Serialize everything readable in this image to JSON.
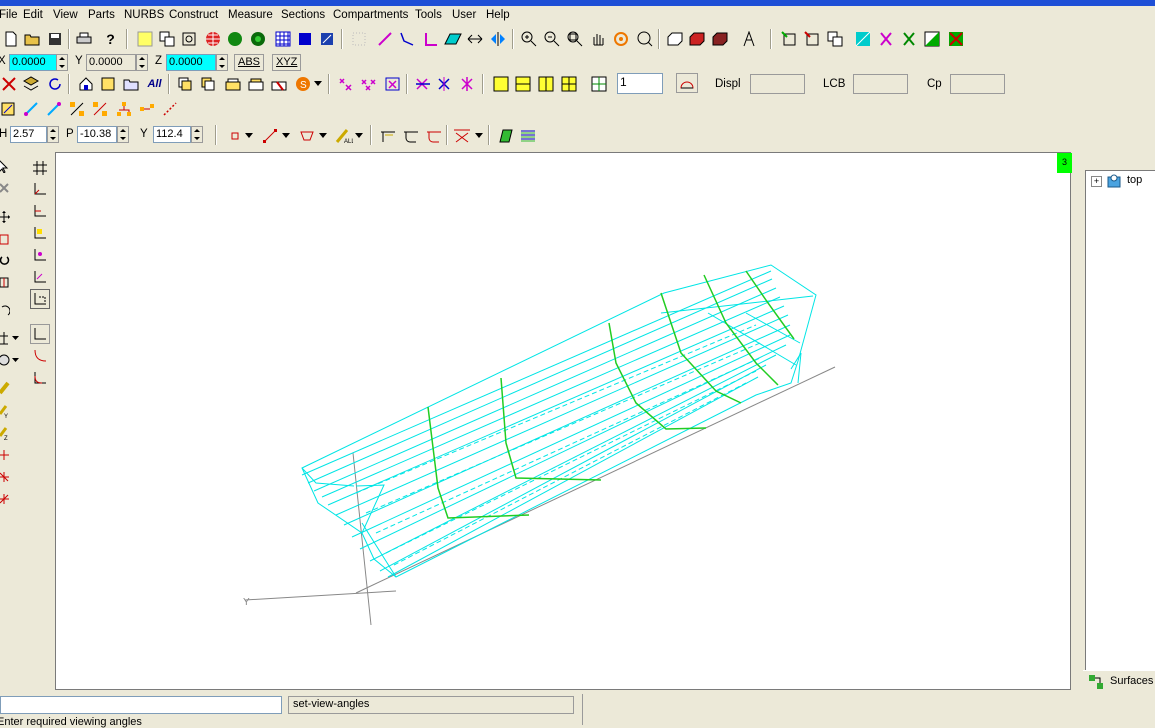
{
  "menu": [
    "File",
    "Edit",
    "View",
    "Parts",
    "NURBS",
    "Construct",
    "Measure",
    "Sections",
    "Compartments",
    "Tools",
    "User",
    "Help"
  ],
  "coords": {
    "x_label": "X",
    "x_value": "0.0000",
    "y_label": "Y",
    "y_value": "0.0000",
    "z_label": "Z",
    "z_value": "0.0000",
    "abs_label": "ABS",
    "xyz_label": "XYZ"
  },
  "hydro": {
    "count_value": "1",
    "displ_label": "Displ",
    "displ_value": "",
    "lcb_label": "LCB",
    "lcb_value": "",
    "cp_label": "Cp",
    "cp_value": ""
  },
  "view_angles": {
    "h_label": "H",
    "h_value": "2.57",
    "p_label": "P",
    "p_value": "-10.38",
    "y_label": "Y",
    "y_value": "112.4"
  },
  "viewport": {
    "badge": "3",
    "axis_label": "Y"
  },
  "tree": {
    "root_label": "top",
    "surfaces_label": "Surfaces"
  },
  "status": {
    "command_input": "",
    "command_name": "set-view-angles",
    "prompt": "Enter required viewing angles"
  },
  "colors": {
    "hull_wire": "#00e5e5",
    "section_line": "#22cc22",
    "badge": "#00ff00",
    "highlight_field": "#00ffff"
  }
}
